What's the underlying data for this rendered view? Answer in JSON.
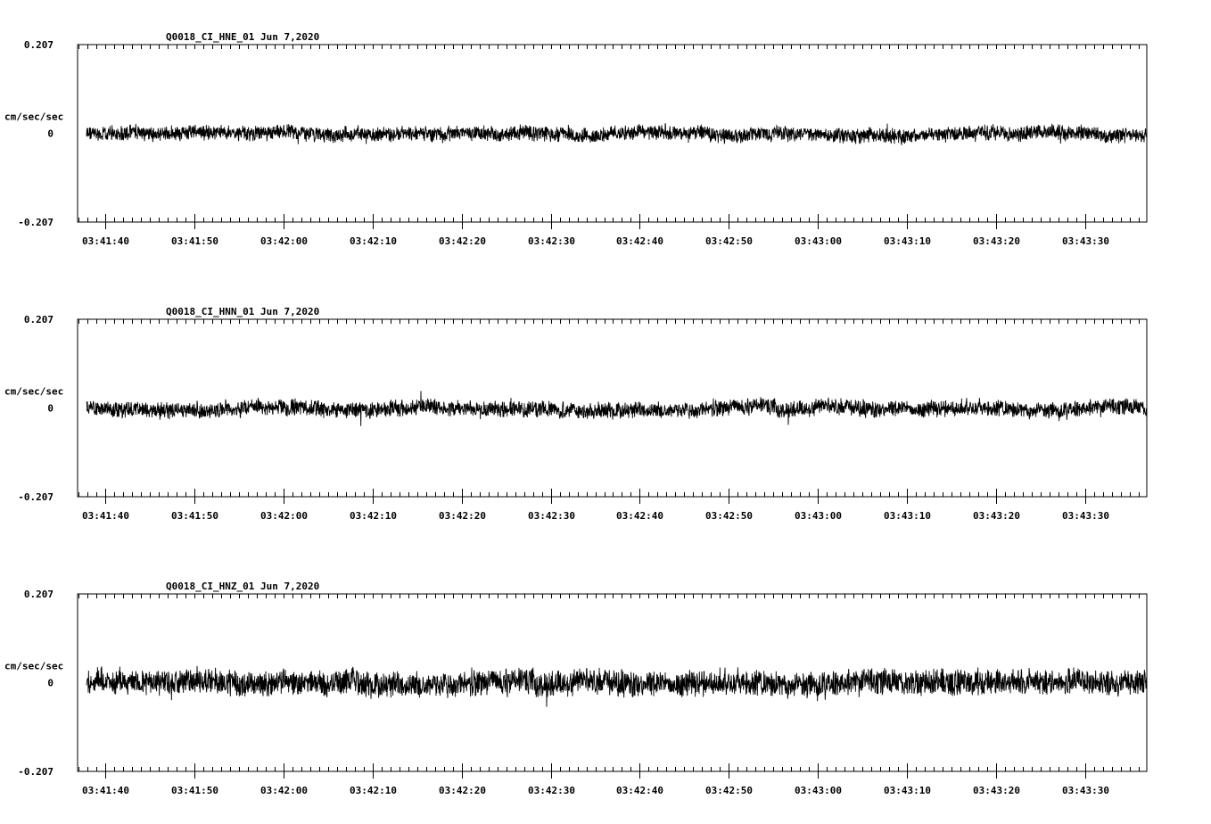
{
  "chart_data": [
    {
      "type": "line",
      "title": "Q0018_CI_HNE_01  Jun 7,2020",
      "ylabel": "cm/sec/sec",
      "ylim": [
        -0.207,
        0.207
      ],
      "y_tick_labels": [
        "0.207",
        "0",
        "-0.207"
      ],
      "x_tick_labels": [
        "03:41:40",
        "03:41:50",
        "03:42:00",
        "03:42:10",
        "03:42:20",
        "03:42:30",
        "03:42:40",
        "03:42:50",
        "03:43:00",
        "03:43:10",
        "03:43:20",
        "03:43:30"
      ],
      "xlim_seconds_after_03_41_00": [
        36.9,
        156.9
      ],
      "trace_span_seconds_after_03_41_00": [
        37.9,
        156.9
      ],
      "trace_amplitude": 0.02,
      "line_color": "#000000"
    },
    {
      "type": "line",
      "title": "Q0018_CI_HNN_01  Jun 7,2020",
      "ylabel": "cm/sec/sec",
      "ylim": [
        -0.207,
        0.207
      ],
      "y_tick_labels": [
        "0.207",
        "0",
        "-0.207"
      ],
      "x_tick_labels": [
        "03:41:40",
        "03:41:50",
        "03:42:00",
        "03:42:10",
        "03:42:20",
        "03:42:30",
        "03:42:40",
        "03:42:50",
        "03:43:00",
        "03:43:10",
        "03:43:20",
        "03:43:30"
      ],
      "xlim_seconds_after_03_41_00": [
        36.9,
        156.9
      ],
      "trace_span_seconds_after_03_41_00": [
        37.9,
        156.9
      ],
      "trace_amplitude": 0.022,
      "line_color": "#000000"
    },
    {
      "type": "line",
      "title": "Q0018_CI_HNZ_01  Jun 7,2020",
      "ylabel": "cm/sec/sec",
      "ylim": [
        -0.207,
        0.207
      ],
      "y_tick_labels": [
        "0.207",
        "0",
        "-0.207"
      ],
      "x_tick_labels": [
        "03:41:40",
        "03:41:50",
        "03:42:00",
        "03:42:10",
        "03:42:20",
        "03:42:30",
        "03:42:40",
        "03:42:50",
        "03:43:00",
        "03:43:10",
        "03:43:20",
        "03:43:30"
      ],
      "xlim_seconds_after_03_41_00": [
        36.9,
        156.9
      ],
      "trace_span_seconds_after_03_41_00": [
        37.9,
        156.9
      ],
      "trace_amplitude": 0.035,
      "line_color": "#000000"
    }
  ]
}
